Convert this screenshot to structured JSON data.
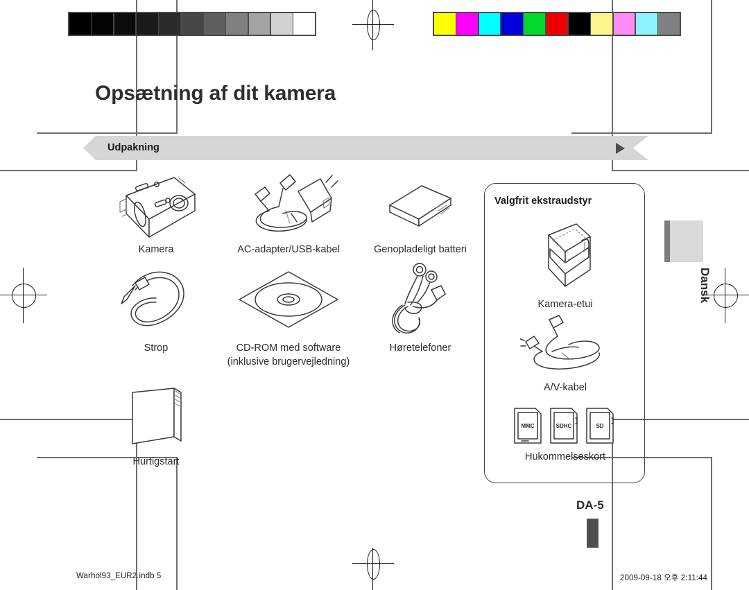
{
  "document": {
    "page_title": "Opsætning af dit kamera",
    "section_banner": "Udpakning",
    "page_number": "DA-5",
    "language_tab": "Dansk"
  },
  "included_items": [
    {
      "label": "Kamera",
      "icon": "camera-icon"
    },
    {
      "label": "AC-adapter/USB-kabel",
      "icon": "ac-adapter-usb-cable-icon"
    },
    {
      "label": "Genopladeligt batteri",
      "icon": "battery-icon"
    },
    {
      "label": "Strop",
      "icon": "wrist-strap-icon"
    },
    {
      "label": "CD-ROM med software\n(inklusive brugervejledning)",
      "icon": "cd-rom-icon"
    },
    {
      "label": "Høretelefoner",
      "icon": "earphones-icon"
    },
    {
      "label": "Hurtigstart",
      "icon": "quick-start-guide-icon"
    }
  ],
  "optional_accessories": {
    "title": "Valgfrit ekstraudstyr",
    "items": [
      {
        "label": "Kamera-etui",
        "icon": "camera-case-icon"
      },
      {
        "label": "A/V-kabel",
        "icon": "av-cable-icon"
      },
      {
        "label": "Hukommelseskort",
        "icon": "memory-cards-icon"
      }
    ],
    "memory_cards": [
      "MMC",
      "SDHC",
      "SD"
    ]
  },
  "print_calibration": {
    "grayscale_label": "grayscale-calibration-strip",
    "grayscale_swatches": [
      "#000000",
      "#040404",
      "#0c0c0c",
      "#1a1a1a",
      "#2b2b2b",
      "#474747",
      "#5e5e5e",
      "#808080",
      "#a3a3a3",
      "#d2d2d2",
      "#ffffff"
    ],
    "color_label": "color-calibration-strip",
    "color_swatches": [
      "#ffff00",
      "#ff00ff",
      "#00ffff",
      "#0000d8",
      "#00d82b",
      "#ee0000",
      "#000000",
      "#fdf58c",
      "#ff8cf4",
      "#8cf3ff",
      "#808080"
    ]
  },
  "footer": {
    "file_name": "Warhol93_EUR2.indb   5",
    "timestamp": "2009-09-18   오후 2:11:44"
  }
}
